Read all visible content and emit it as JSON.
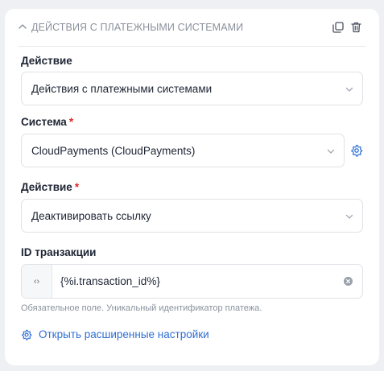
{
  "block": {
    "title": "Действия с платежными системами"
  },
  "fields": {
    "action_group": {
      "label": "Действие",
      "value": "Действия с платежными системами"
    },
    "system": {
      "label": "Система",
      "required_mark": "*",
      "value": "CloudPayments (CloudPayments)"
    },
    "action": {
      "label": "Действие",
      "required_mark": "*",
      "value": "Деактивировать ссылку"
    },
    "transaction_id": {
      "label": "ID транзакции",
      "prefix": "‹›",
      "value": "{%i.transaction_id%}",
      "hint": "Обязательное поле. Уникальный идентификатор платежа."
    }
  },
  "advanced": {
    "label": "Открыть расширенные настройки"
  },
  "colors": {
    "accent": "#2f6fd6",
    "required": "#e02424",
    "muted": "#8a919c",
    "text": "#1d2433",
    "border": "#dfe2e7",
    "background": "#eef0f3"
  },
  "icons": {
    "collapse": "chevron-up-icon",
    "copy": "copy-icon",
    "delete": "trash-icon",
    "select_chevron": "chevron-down-icon",
    "settings": "gear-icon",
    "code": "code-brackets-icon",
    "clear": "clear-circle-icon",
    "advanced": "gear-icon"
  }
}
